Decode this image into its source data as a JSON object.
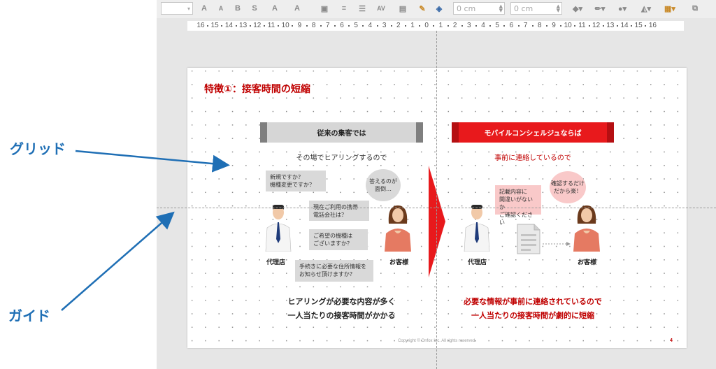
{
  "annotations": {
    "grid": "グリッド",
    "guide": "ガイド"
  },
  "toolbar": {
    "position_x": "0 cm",
    "position_y": "0 cm",
    "items": [
      "A",
      "A",
      "B",
      "S",
      "A",
      "A"
    ]
  },
  "ruler": {
    "ticks": [
      "16",
      "15",
      "14",
      "13",
      "12",
      "11",
      "10",
      "9",
      "8",
      "7",
      "6",
      "5",
      "4",
      "3",
      "2",
      "1",
      "0",
      "1",
      "2",
      "3",
      "4",
      "5",
      "6",
      "7",
      "8",
      "9",
      "10",
      "11",
      "12",
      "13",
      "14",
      "15",
      "16"
    ]
  },
  "slide": {
    "title": "特徴①：接客時間の短縮",
    "left": {
      "header": "従来の集客では",
      "subtitle": "その場でヒアリングするので",
      "bubbles": [
        "新規ですか？\n機種変更ですか？",
        "現在ご利用の携帯\n電話会社は？",
        "ご希望の機種は\nございますか？",
        "手続きに必要な住所情報を\nお知らせ頂けますか？"
      ],
      "customer_bubble": "答えるのが\n面倒…",
      "agent_label": "代理店",
      "customer_label": "お客様",
      "summary_line1": "ヒアリングが必要な内容が多く",
      "summary_line2": "一人当たりの接客時間がかかる"
    },
    "right": {
      "header": "モバイルコンシェルジュならば",
      "subtitle": "事前に連絡しているので",
      "agent_bubble": "記載内容に\n間違いがないか\nご確認ください",
      "customer_bubble": "確認するだけ\nだから楽！",
      "agent_label": "代理店",
      "customer_label": "お客様",
      "summary_line1": "必要な情報が事前に連絡されているので",
      "summary_line2": "一人当たりの接客時間が劇的に短縮"
    },
    "footer": "Copyright © Onfox Inc. All rights reserved.",
    "page_number": "4",
    "colors": {
      "accent_red": "#e8191c",
      "title_red": "#c00000",
      "gray_header": "#d6d6d6"
    }
  }
}
